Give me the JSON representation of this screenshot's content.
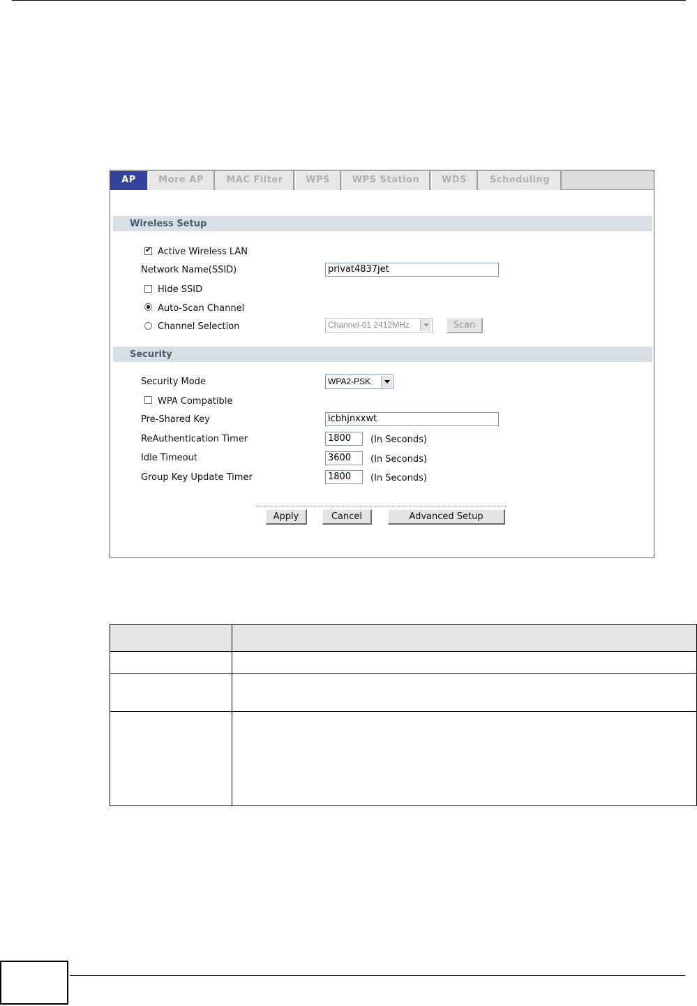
{
  "tabs": [
    {
      "label": "AP",
      "active": true
    },
    {
      "label": "More AP",
      "active": false
    },
    {
      "label": "MAC Filter",
      "active": false
    },
    {
      "label": "WPS",
      "active": false
    },
    {
      "label": "WPS Station",
      "active": false
    },
    {
      "label": "WDS",
      "active": false
    },
    {
      "label": "Scheduling",
      "active": false
    }
  ],
  "wireless_setup": {
    "title": "Wireless Setup",
    "active_wlan": {
      "label": "Active Wireless LAN",
      "checked": true
    },
    "ssid": {
      "label": "Network Name(SSID)",
      "value": "privat4837jet"
    },
    "hide_ssid": {
      "label": "Hide SSID",
      "checked": false
    },
    "auto_scan": {
      "label": "Auto-Scan Channel",
      "selected": true
    },
    "channel_selection": {
      "label": "Channel Selection",
      "selected": false,
      "value": "Channel-01 2412MHz",
      "scan_label": "Scan"
    }
  },
  "security": {
    "title": "Security",
    "mode": {
      "label": "Security Mode",
      "value": "WPA2-PSK"
    },
    "wpa_compatible": {
      "label": "WPA Compatible",
      "checked": false
    },
    "psk": {
      "label": "Pre-Shared Key",
      "value": "icbhjnxxwt"
    },
    "reauth": {
      "label": "ReAuthentication Timer",
      "value": "1800",
      "unit": "(In Seconds)"
    },
    "idle": {
      "label": "Idle Timeout",
      "value": "3600",
      "unit": "(In Seconds)"
    },
    "group_key": {
      "label": "Group Key Update Timer",
      "value": "1800",
      "unit": "(In Seconds)"
    }
  },
  "buttons": {
    "apply": "Apply",
    "cancel": "Cancel",
    "advanced": "Advanced Setup"
  },
  "colors": {
    "active_tab": "#35429a",
    "section_bar": "#d8e0e6",
    "section_text": "#4b5a73"
  }
}
